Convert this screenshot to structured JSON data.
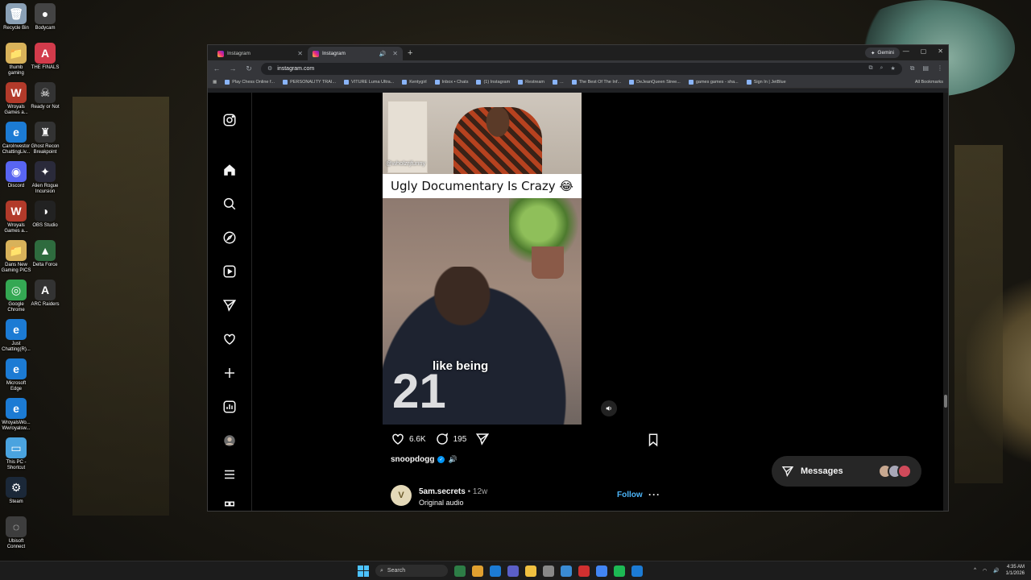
{
  "desktop": {
    "icons": [
      {
        "label": "Recycle Bin",
        "color": "#8aa0b5",
        "glyph": "🗑"
      },
      {
        "label": "thumb\ngaming",
        "color": "#d8b25a",
        "glyph": "📁"
      },
      {
        "label": "Wroyals\nGames a...",
        "color": "#b23a2a",
        "glyph": "W"
      },
      {
        "label": "CaroInvestor\nChattingLiv...",
        "color": "#1c7bd4",
        "glyph": "e"
      },
      {
        "label": "Discord",
        "color": "#5865f2",
        "glyph": "◉"
      },
      {
        "label": "Wroyals\nGames a...",
        "color": "#b23a2a",
        "glyph": "W"
      },
      {
        "label": "Dans New\nGaming PICS",
        "color": "#d8b25a",
        "glyph": "📁"
      },
      {
        "label": "Google\nChrome",
        "color": "#34a853",
        "glyph": "◎"
      },
      {
        "label": "Just\nChatting(R)...",
        "color": "#1c7bd4",
        "glyph": "e"
      },
      {
        "label": "Microsoft\nEdge",
        "color": "#1c7bd4",
        "glyph": "e"
      },
      {
        "label": "WroyalsWo...\nWwroyalsw...",
        "color": "#1c7bd4",
        "glyph": "e"
      },
      {
        "label": "This PC -\nShortcut",
        "color": "#4aa3df",
        "glyph": "▭"
      },
      {
        "label": "Steam",
        "color": "#1b2838",
        "glyph": "⚙"
      },
      {
        "label": "Ubisoft\nConnect",
        "color": "#3d3d3d",
        "glyph": "◌"
      }
    ],
    "icons2": [
      {
        "label": "Bodycam",
        "color": "#444",
        "glyph": "●"
      },
      {
        "label": "THE FINALS",
        "color": "#d23b4b",
        "glyph": "A"
      },
      {
        "label": "Ready or Not",
        "color": "#333",
        "glyph": "☠"
      },
      {
        "label": "Ghost Recon\nBreakpoint",
        "color": "#333",
        "glyph": "♜"
      },
      {
        "label": "Alien Rogue\nIncursion",
        "color": "#2a2a3a",
        "glyph": "✦"
      },
      {
        "label": "OBS Studio",
        "color": "#222",
        "glyph": "◑"
      },
      {
        "label": "Delta Force",
        "color": "#2e6b3e",
        "glyph": "▲"
      },
      {
        "label": "ARC Raiders",
        "color": "#333",
        "glyph": "A"
      }
    ]
  },
  "browser": {
    "tabs": [
      {
        "label": "Instagram"
      },
      {
        "label": "Instagram"
      }
    ],
    "gemini_label": "Gemini",
    "url": "instagram.com",
    "bookmarks": [
      "Play Chess Online f...",
      "PERSONALITY TRAI...",
      "VITURE Luma Ultra...",
      "Kentygirl",
      "Inbox • Chats",
      "(1) Instagram",
      "Restream",
      "...",
      "The Best Of The Inf...",
      "DeJeanQueen Stree...",
      "games games - sha...",
      "Sign In | JetBlue"
    ],
    "all_bookmarks": "All Bookmarks"
  },
  "post": {
    "watermark": "@wholzrjfunny",
    "caption": "Ugly Documentary Is Crazy 😂",
    "subtitle": "like being",
    "jersey_number": "21",
    "likes": "6.6K",
    "comments": "195",
    "owner": "snoopdogg"
  },
  "next_post": {
    "avatar_letter": "V",
    "username": "5am.secrets",
    "time": "• 12w",
    "audio": "Original audio",
    "follow": "Follow"
  },
  "messages": {
    "label": "Messages"
  },
  "taskbar": {
    "search_placeholder": "Search",
    "time": "4:35 AM",
    "date": "1/1/2026",
    "apps": [
      "#2d7d46",
      "#e0a030",
      "#1c7bd4",
      "#5b5fc7",
      "#f0c040",
      "#888",
      "#3a8bd4",
      "#d03030",
      "#4285f4",
      "#1db954",
      "#1c7bd4"
    ]
  },
  "colors": {
    "accent_follow": "#4cb5f9",
    "verified": "#0095f6"
  }
}
